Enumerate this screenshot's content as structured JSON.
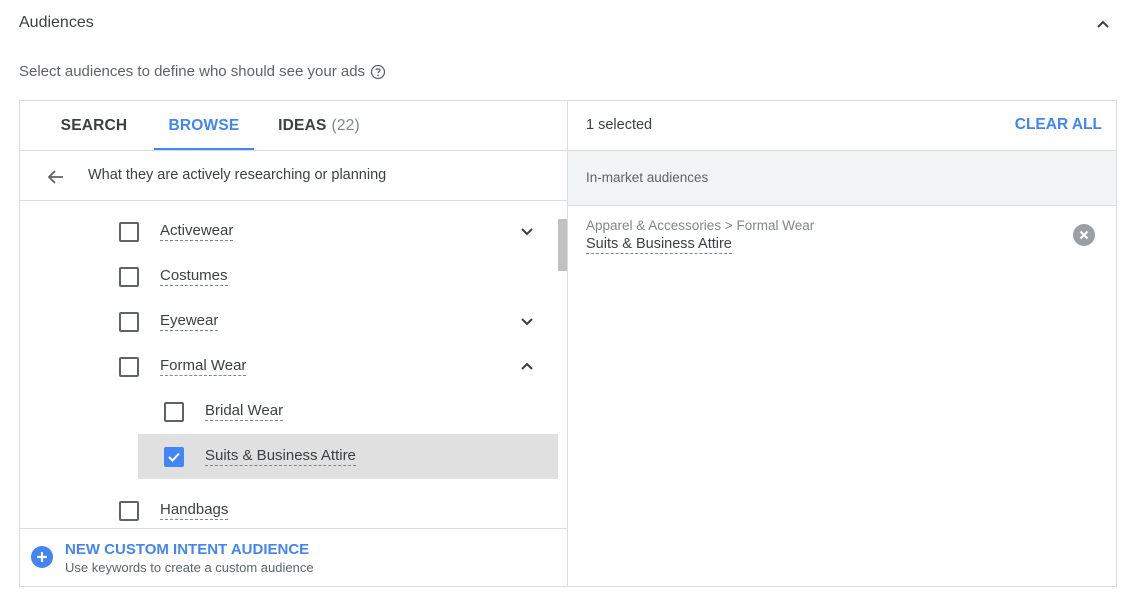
{
  "section": {
    "title": "Audiences",
    "subtitle": "Select audiences to define who should see your ads"
  },
  "tabs": [
    {
      "label": "SEARCH"
    },
    {
      "label": "BROWSE"
    },
    {
      "label": "IDEAS",
      "count": "(22)"
    }
  ],
  "breadcrumb": {
    "label": "What they are actively researching or planning"
  },
  "list": [
    {
      "label": "Activewear",
      "checked": false,
      "expand": "collapsed"
    },
    {
      "label": "Costumes",
      "checked": false
    },
    {
      "label": "Eyewear",
      "checked": false,
      "expand": "collapsed"
    },
    {
      "label": "Formal Wear",
      "checked": false,
      "expand": "expanded"
    },
    {
      "label": "Bridal Wear",
      "checked": false
    },
    {
      "label": "Suits & Business Attire",
      "checked": true
    },
    {
      "label": "Handbags",
      "checked": false
    }
  ],
  "footer": {
    "title": "NEW CUSTOM INTENT AUDIENCE",
    "subtitle": "Use keywords to create a custom audience"
  },
  "selection": {
    "count_label": "1 selected",
    "clear_label": "CLEAR ALL",
    "group_title": "In-market audiences",
    "item_path": "Apparel & Accessories > Formal Wear",
    "item_name": "Suits & Business Attire"
  },
  "colors": {
    "accent": "#4285f4",
    "selected_row": "#e0e0e0",
    "group_header": "#f1f3f4"
  },
  "icons": {
    "collapse": "chevron-up-icon",
    "help": "help-circle-icon",
    "back": "arrow-left-icon",
    "add": "plus-circle-icon",
    "remove": "close-circle-icon"
  }
}
